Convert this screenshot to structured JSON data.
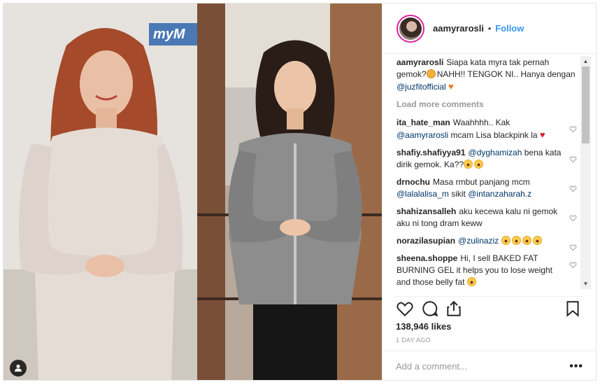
{
  "photo": {
    "overlay_text": "myM",
    "tag_icon": "user-tag-icon"
  },
  "header": {
    "username": "aamyrarosli",
    "separator": "•",
    "follow_label": "Follow"
  },
  "caption": {
    "username": "aamyrarosli",
    "text": "Siapa kata myra tak pernah gemok?",
    "text2": "NAHH!! TENGOK NI.. Hanya dengan",
    "mention": "@juzfitofficial"
  },
  "load_more": "Load more comments",
  "comments": [
    {
      "user": "ita_hate_man",
      "parts": [
        {
          "t": "text",
          "v": "Waahhhh.. Kak "
        },
        {
          "t": "mention",
          "v": "@aamyrarosli"
        },
        {
          "t": "text",
          "v": " mcam Lisa blackpink la "
        }
      ]
    },
    {
      "user": "shafiy.shafiyya91",
      "parts": [
        {
          "t": "mention",
          "v": "@dyghamizah"
        },
        {
          "t": "text",
          "v": " bena kata dirik gemok. Ka??"
        }
      ]
    },
    {
      "user": "drnochu",
      "parts": [
        {
          "t": "text",
          "v": "Masa rmbut panjang mcm "
        },
        {
          "t": "mention",
          "v": "@lalalalisa_m"
        },
        {
          "t": "text",
          "v": " sikit "
        },
        {
          "t": "mention",
          "v": "@intanzaharah.z"
        }
      ]
    },
    {
      "user": "shahizansalleh",
      "parts": [
        {
          "t": "text",
          "v": "aku kecewa kalu ni gemok aku ni tong dram keww"
        }
      ]
    },
    {
      "user": "norazilasupian",
      "parts": [
        {
          "t": "mention",
          "v": "@zulinaziz"
        },
        {
          "t": "text",
          "v": " "
        }
      ]
    },
    {
      "user": "sheena.shoppe",
      "parts": [
        {
          "t": "text",
          "v": "Hi, I sell BAKED FAT BURNING GEL it helps you to lose weight and those belly fat "
        }
      ]
    }
  ],
  "likes": "138,946 likes",
  "age": "1 DAY AGO",
  "add_comment": {
    "placeholder": "Add a comment...",
    "more_label": "•••"
  }
}
